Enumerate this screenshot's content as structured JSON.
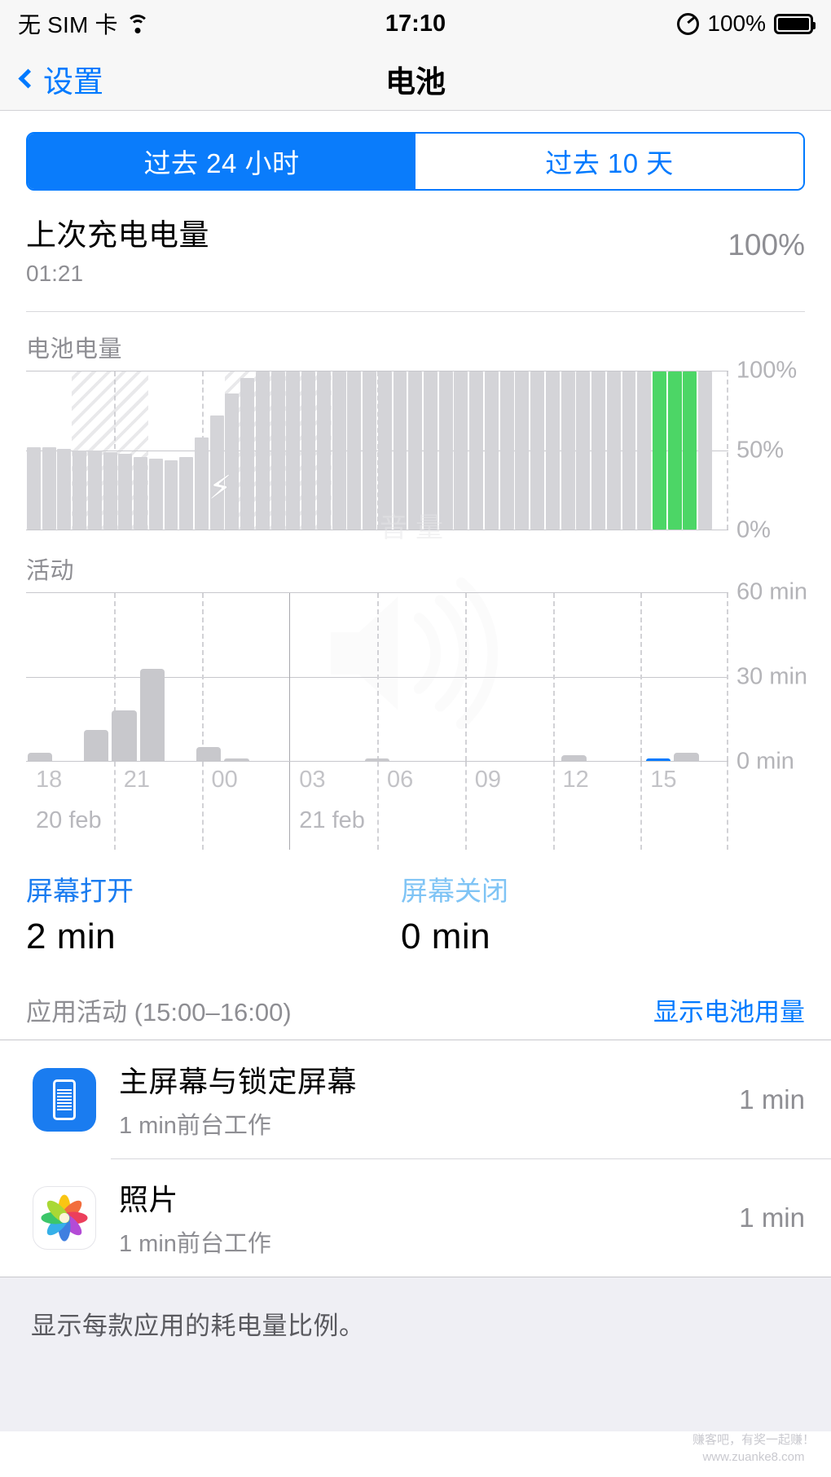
{
  "status_bar": {
    "carrier": "无 SIM 卡",
    "wifi_icon": "wifi-icon",
    "time": "17:10",
    "rotation_lock_icon": "rotation-lock-icon",
    "battery_percent": "100%",
    "battery_icon": "battery-full-icon"
  },
  "nav": {
    "back_label": "设置",
    "back_icon": "chevron-left-icon",
    "title": "电池"
  },
  "segmented": {
    "options": [
      {
        "label": "过去 24 小时",
        "selected": true
      },
      {
        "label": "过去 10 天",
        "selected": false
      }
    ]
  },
  "last_charge": {
    "title": "上次充电电量",
    "time": "01:21",
    "percent": "100%"
  },
  "battery_chart_label": "电池电量",
  "activity_chart_label": "活动",
  "charging_bolt_icon": "lightning-bolt-icon",
  "volume_hud_watermark": {
    "text": "音量",
    "icon": "speaker-volume-icon"
  },
  "screen_time": {
    "on_label": "屏幕打开",
    "on_value": "2 min",
    "off_label": "屏幕关闭",
    "off_value": "0 min",
    "on_color": "#1a7cf0",
    "off_color": "#7fc4f5"
  },
  "app_activity": {
    "header": "应用活动 (15:00–16:00)",
    "action_label": "显示电池用量",
    "rows": [
      {
        "icon": "home-lock-screen-icon",
        "name": "主屏幕与锁定屏幕",
        "detail": "1 min前台工作",
        "time": "1 min"
      },
      {
        "icon": "photos-app-icon",
        "name": "照片",
        "detail": "1 min前台工作",
        "time": "1 min"
      }
    ]
  },
  "footer_note": "显示每款应用的耗电量比例。",
  "corner_watermark": {
    "line1": "赚客吧，有奖一起赚！",
    "line2": "www.zuanke8.com"
  },
  "colors": {
    "accent_blue": "#007aff",
    "selected_blue": "#0a7cfb",
    "charge_green": "#4cd666",
    "bar_gray": "#d4d4d8",
    "activity_blue": "#007aff"
  },
  "chart_data": [
    {
      "type": "bar",
      "title": "电池电量",
      "ylabel": "",
      "xlabel": "",
      "ylim": [
        0,
        100
      ],
      "yticks": [
        0,
        50,
        100
      ],
      "ytick_labels": [
        "0%",
        "50%",
        "100%"
      ],
      "grid": true,
      "legend": "none",
      "x_start": "17:00 20 feb",
      "x_end": "17:00 21 feb",
      "bar_color": "#d4d4d8",
      "current_color": "#4cd666",
      "charging_hatch_ranges": [
        [
          3,
          8
        ],
        [
          13,
          20
        ]
      ],
      "green_bar_indices": [
        41,
        42,
        43
      ],
      "values": [
        52,
        52,
        51,
        50,
        50,
        49,
        48,
        46,
        45,
        44,
        46,
        58,
        72,
        86,
        96,
        100,
        100,
        100,
        100,
        100,
        100,
        100,
        100,
        100,
        100,
        100,
        100,
        100,
        100,
        100,
        100,
        100,
        100,
        100,
        100,
        100,
        100,
        100,
        100,
        100,
        100,
        100,
        100,
        100,
        100,
        0
      ]
    },
    {
      "type": "bar",
      "title": "活动",
      "ylabel": "",
      "xlabel": "",
      "ylim": [
        0,
        60
      ],
      "yticks": [
        0,
        30,
        60
      ],
      "ytick_labels": [
        "0 min",
        "30 min",
        "60 min"
      ],
      "grid": true,
      "legend": "none",
      "xtick_labels": [
        "18",
        "21",
        "00",
        "03",
        "06",
        "09",
        "12",
        "15"
      ],
      "date_labels": [
        "20 feb",
        "21 feb"
      ],
      "bar_color": "#c8c8cc",
      "highlight_color": "#007aff",
      "highlight_index": 22,
      "values": [
        3,
        0,
        11,
        18,
        33,
        0,
        5,
        1,
        0,
        0,
        0,
        0,
        1,
        0,
        0,
        0,
        0,
        0,
        0,
        2,
        0,
        0,
        1,
        3,
        0
      ]
    }
  ]
}
